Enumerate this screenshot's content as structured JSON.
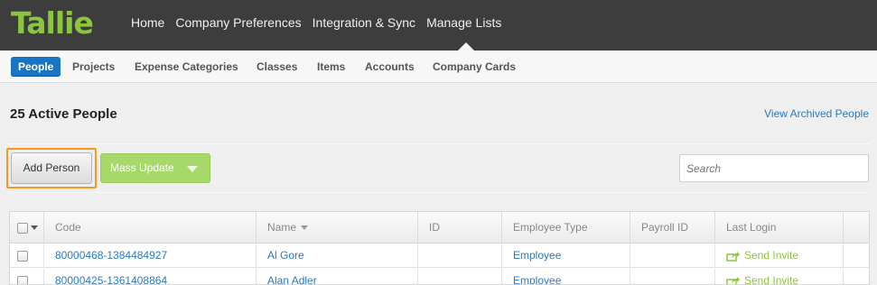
{
  "app": {
    "logo": "Tallie"
  },
  "topnav": {
    "items": [
      "Home",
      "Company Preferences",
      "Integration & Sync",
      "Manage Lists"
    ]
  },
  "subnav": {
    "tabs": [
      "People",
      "Projects",
      "Expense Categories",
      "Classes",
      "Items",
      "Accounts",
      "Company Cards"
    ],
    "active": "People"
  },
  "main": {
    "title": "25 Active People",
    "archived_link": "View Archived People",
    "add_person": "Add Person",
    "mass_update": "Mass Update",
    "search_placeholder": "Search"
  },
  "table": {
    "headers": [
      "Code",
      "Name",
      "ID",
      "Employee Type",
      "Payroll ID",
      "Last Login"
    ],
    "rows": [
      {
        "code": "80000468-1384484927",
        "name": "Al Gore",
        "id": "",
        "type": "Employee",
        "payroll": "",
        "last_login": "Send Invite"
      },
      {
        "code": "80000425-1361408864",
        "name": "Alan Adler",
        "id": "",
        "type": "Employee",
        "payroll": "",
        "last_login": "Send Invite"
      }
    ]
  },
  "colors": {
    "nav_bg": "#3d3d3d",
    "brand_green": "#8cc63f",
    "active_tab": "#1a74c4",
    "link": "#2a7ac0",
    "highlight_outline": "#f29b21"
  }
}
